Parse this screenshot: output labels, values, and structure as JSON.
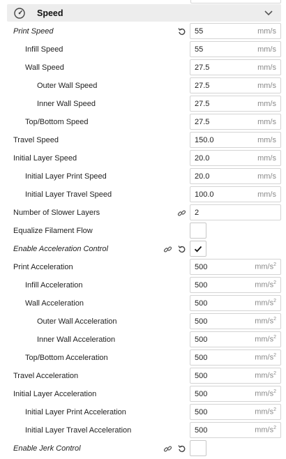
{
  "section": {
    "title": "Speed",
    "icon": "speedometer-icon",
    "collapse_icon": "chevron-down-icon"
  },
  "units": {
    "speed": "mm/s",
    "accel_base": "mm/s",
    "accel_exp": "2"
  },
  "rows": [
    {
      "label": "Print Speed",
      "value": "55",
      "unit": "mm/s",
      "italic": true,
      "reset": true
    },
    {
      "label": "Infill Speed",
      "value": "55",
      "unit": "mm/s"
    },
    {
      "label": "Wall Speed",
      "value": "27.5",
      "unit": "mm/s"
    },
    {
      "label": "Outer Wall Speed",
      "value": "27.5",
      "unit": "mm/s"
    },
    {
      "label": "Inner Wall Speed",
      "value": "27.5",
      "unit": "mm/s"
    },
    {
      "label": "Top/Bottom Speed",
      "value": "27.5",
      "unit": "mm/s"
    },
    {
      "label": "Travel Speed",
      "value": "150.0",
      "unit": "mm/s"
    },
    {
      "label": "Initial Layer Speed",
      "value": "20.0",
      "unit": "mm/s"
    },
    {
      "label": "Initial Layer Print Speed",
      "value": "20.0",
      "unit": "mm/s"
    },
    {
      "label": "Initial Layer Travel Speed",
      "value": "100.0",
      "unit": "mm/s"
    },
    {
      "label": "Number of Slower Layers",
      "value": "2",
      "unit": "",
      "link": true
    },
    {
      "label": "Equalize Filament Flow",
      "checked": false
    },
    {
      "label": "Enable Acceleration Control",
      "checked": true,
      "italic": true,
      "link": true,
      "reset": true
    },
    {
      "label": "Print Acceleration",
      "value": "500"
    },
    {
      "label": "Infill Acceleration",
      "value": "500"
    },
    {
      "label": "Wall Acceleration",
      "value": "500"
    },
    {
      "label": "Outer Wall Acceleration",
      "value": "500"
    },
    {
      "label": "Inner Wall Acceleration",
      "value": "500"
    },
    {
      "label": "Top/Bottom Acceleration",
      "value": "500"
    },
    {
      "label": "Travel Acceleration",
      "value": "500"
    },
    {
      "label": "Initial Layer Acceleration",
      "value": "500"
    },
    {
      "label": "Initial Layer Print Acceleration",
      "value": "500"
    },
    {
      "label": "Initial Layer Travel Acceleration",
      "value": "500"
    },
    {
      "label": "Enable Jerk Control",
      "checked": false,
      "italic": true,
      "link": true,
      "reset": true
    }
  ],
  "colors": {
    "header_bg": "#ededed",
    "field_border": "#d4d4d4",
    "unit_text": "#8a8a8a"
  }
}
